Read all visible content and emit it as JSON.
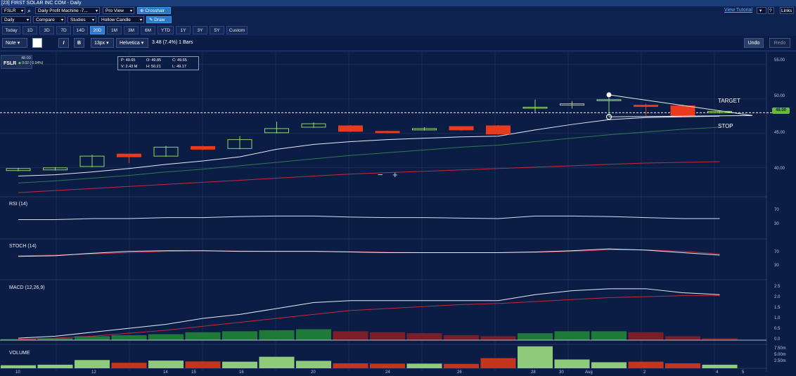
{
  "window": {
    "title": "[23] FIRST SOLAR INC COM - Daily"
  },
  "toolbar1": {
    "symbol": "FSLR",
    "study_template": "Daily Profit Machine -7...",
    "view": "Pro View",
    "crosshair": "Crosshair",
    "view_tutorial": "View Tutorial",
    "links": "Links"
  },
  "toolbar2": {
    "period": "Daily",
    "compare": "Compare",
    "studies": "Studies",
    "chart_style": "Hollow Candle",
    "draw": "Draw"
  },
  "timeframes": [
    "Today",
    "1D",
    "3D",
    "7D",
    "14D",
    "20D",
    "1M",
    "3M",
    "6M",
    "YTD",
    "1Y",
    "3Y",
    "5Y",
    "Custom"
  ],
  "active_timeframe": "20D",
  "drawing_toolbar": {
    "note": "Note",
    "italic": "I",
    "bold": "B",
    "font_size": "13px",
    "font": "Helvetica",
    "measure": "3.48 (7.4%) 1 Bars",
    "undo": "Undo",
    "redo": "Redo"
  },
  "ticker_box": {
    "symbol": "FSLR",
    "price": "48.00",
    "change": "0.02 ( 0.04%)"
  },
  "ohlc_box": {
    "p": "P: 49.65",
    "o": "O: 49.85",
    "c": "C: 49.65",
    "v": "V: 2.43 M",
    "h": "H: 50.21",
    "l": "L: 49.17"
  },
  "zoom": {
    "out": "−",
    "in": "+"
  },
  "annotations": {
    "target": "TARGET",
    "stop": "STOP"
  },
  "price_marker": "48.00",
  "panels": {
    "rsi": "RSI (14)",
    "stoch": "STOCH (14)",
    "macd": "MACD (12,26,9)",
    "volume": "VOLUME"
  },
  "price_axis": [
    "55.00",
    "50.00",
    "45.00",
    "40.00"
  ],
  "rsi_axis": [
    "70",
    "30"
  ],
  "stoch_axis": [
    "70",
    "30"
  ],
  "macd_axis": [
    "2.5",
    "2.0",
    "1.5",
    "1.0",
    "0.5",
    "0.0"
  ],
  "volume_axis": [
    "7.50m",
    "5.00m",
    "2.50m"
  ],
  "x_axis": [
    "10",
    "12",
    "14",
    "15",
    "16",
    "20",
    "24",
    "26",
    "28",
    "30",
    "Aug",
    "2",
    "4",
    "5"
  ],
  "colors": {
    "background": "#0c1d45",
    "up_candle": "#8fd46a",
    "down_candle": "#e83a1c",
    "macd_pos": "#1f7a3a",
    "macd_neg": "#7a1f2a",
    "vol_up": "#8fc97a",
    "vol_down": "#c4351d",
    "accent": "#2f7ad0"
  },
  "chart_data": {
    "type": "candlestick",
    "title": "FIRST SOLAR INC COM - Daily",
    "y_range": [
      36,
      56
    ],
    "candles": [
      {
        "o": 39.6,
        "c": 39.9,
        "h": 40.0,
        "l": 39.5,
        "up": true
      },
      {
        "o": 39.7,
        "c": 40.0,
        "h": 40.1,
        "l": 39.6,
        "up": true
      },
      {
        "o": 40.2,
        "c": 41.7,
        "h": 41.9,
        "l": 40.1,
        "up": true
      },
      {
        "o": 42.0,
        "c": 41.6,
        "h": 42.0,
        "l": 40.7,
        "up": false
      },
      {
        "o": 41.7,
        "c": 43.0,
        "h": 43.2,
        "l": 41.6,
        "up": true
      },
      {
        "o": 43.1,
        "c": 42.7,
        "h": 43.2,
        "l": 42.6,
        "up": false
      },
      {
        "o": 42.8,
        "c": 44.1,
        "h": 44.6,
        "l": 42.7,
        "up": true
      },
      {
        "o": 45.1,
        "c": 45.7,
        "h": 46.7,
        "l": 45.0,
        "up": true
      },
      {
        "o": 45.9,
        "c": 46.4,
        "h": 46.6,
        "l": 45.8,
        "up": true
      },
      {
        "o": 46.1,
        "c": 45.3,
        "h": 46.2,
        "l": 45.2,
        "up": false
      },
      {
        "o": 45.3,
        "c": 45.1,
        "h": 45.4,
        "l": 45.0,
        "up": false
      },
      {
        "o": 45.5,
        "c": 45.7,
        "h": 45.9,
        "l": 45.4,
        "up": true
      },
      {
        "o": 46.0,
        "c": 45.5,
        "h": 46.0,
        "l": 45.4,
        "up": false
      },
      {
        "o": 46.1,
        "c": 44.9,
        "h": 46.2,
        "l": 44.8,
        "up": false
      },
      {
        "o": 48.7,
        "c": 48.8,
        "h": 49.9,
        "l": 48.1,
        "up": true
      },
      {
        "o": 49.1,
        "c": 49.3,
        "h": 49.7,
        "l": 48.6,
        "up": true
      },
      {
        "o": 49.8,
        "c": 49.9,
        "h": 50.2,
        "l": 47.4,
        "up": true
      },
      {
        "o": 49.1,
        "c": 48.9,
        "h": 49.3,
        "l": 47.6,
        "up": false
      },
      {
        "o": 49.0,
        "c": 47.5,
        "h": 49.2,
        "l": 47.4,
        "up": false
      },
      {
        "o": 48.2,
        "c": 48.0,
        "h": 48.3,
        "l": 47.9,
        "up": true
      }
    ],
    "ma_white": [
      38.8,
      39.0,
      39.4,
      39.9,
      40.5,
      41.0,
      41.6,
      42.7,
      43.4,
      43.8,
      44.1,
      44.3,
      44.5,
      44.6,
      45.5,
      46.3,
      47.0,
      47.3,
      47.4,
      47.5
    ],
    "ma_green": [
      37.8,
      38.1,
      38.5,
      38.9,
      39.4,
      39.8,
      40.3,
      40.8,
      41.3,
      41.8,
      42.2,
      42.6,
      43.0,
      43.3,
      43.8,
      44.3,
      44.8,
      45.2,
      45.6,
      45.9
    ],
    "ma_red": [
      36.4,
      36.7,
      37.0,
      37.3,
      37.6,
      37.9,
      38.2,
      38.5,
      38.8,
      39.1,
      39.3,
      39.5,
      39.7,
      39.9,
      40.1,
      40.3,
      40.5,
      40.7,
      40.8,
      40.9
    ],
    "rsi": [
      58,
      58,
      62,
      62,
      66,
      66,
      70,
      72,
      72,
      68,
      66,
      66,
      64,
      62,
      72,
      72,
      70,
      66,
      62,
      62
    ],
    "stoch": [
      62,
      64,
      72,
      78,
      80,
      80,
      78,
      78,
      78,
      76,
      74,
      74,
      74,
      74,
      76,
      80,
      86,
      82,
      74,
      66
    ],
    "stoch_signal": [
      64,
      66,
      70,
      74,
      78,
      80,
      79,
      78,
      78,
      77,
      75,
      74,
      74,
      74,
      75,
      78,
      83,
      83,
      78,
      70
    ],
    "macd": [
      0.1,
      0.2,
      0.4,
      0.6,
      0.8,
      1.1,
      1.3,
      1.6,
      1.9,
      2.0,
      2.0,
      2.0,
      2.0,
      2.0,
      2.3,
      2.5,
      2.6,
      2.6,
      2.4,
      2.3
    ],
    "macd_signal": [
      0.05,
      0.1,
      0.2,
      0.35,
      0.5,
      0.7,
      0.9,
      1.1,
      1.3,
      1.5,
      1.6,
      1.7,
      1.8,
      1.85,
      1.95,
      2.05,
      2.15,
      2.2,
      2.25,
      2.25
    ],
    "macd_hist": [
      0.05,
      0.1,
      0.2,
      0.25,
      0.3,
      0.4,
      0.45,
      0.5,
      0.55,
      0.45,
      0.4,
      0.35,
      0.25,
      0.2,
      0.35,
      0.45,
      0.45,
      0.4,
      0.2,
      0.1
    ],
    "volume": [
      1.1,
      1.3,
      3.0,
      2.0,
      2.8,
      2.5,
      2.4,
      4.2,
      2.7,
      1.8,
      1.7,
      1.7,
      1.6,
      3.7,
      8.0,
      3.2,
      2.2,
      2.4,
      1.8,
      1.3
    ],
    "volume_up": [
      true,
      true,
      true,
      false,
      true,
      false,
      true,
      true,
      true,
      false,
      false,
      true,
      false,
      false,
      true,
      true,
      true,
      false,
      false,
      true
    ]
  }
}
